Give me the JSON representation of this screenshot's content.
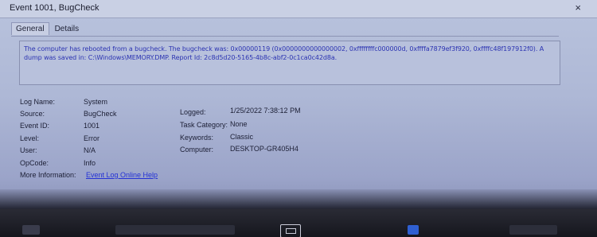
{
  "window": {
    "title": "Event 1001, BugCheck",
    "close_glyph": "×"
  },
  "tabs": [
    {
      "label": "General",
      "active": true
    },
    {
      "label": "Details",
      "active": false
    }
  ],
  "description": "The computer has rebooted from a bugcheck.  The bugcheck was: 0x00000119 (0x0000000000000002, 0xffffffffc000000d, 0xffffa7879ef3f920, 0xffffc48f197912f0). A dump was saved in: C:\\Windows\\MEMORY.DMP. Report Id: 2c8d5d20-5165-4b8c-abf2-0c1ca0c42d8a.",
  "properties": {
    "log_name": {
      "label": "Log Name:",
      "value": "System"
    },
    "source": {
      "label": "Source:",
      "value": "BugCheck"
    },
    "event_id": {
      "label": "Event ID:",
      "value": "1001"
    },
    "level": {
      "label": "Level:",
      "value": "Error"
    },
    "user": {
      "label": "User:",
      "value": "N/A"
    },
    "opcode": {
      "label": "OpCode:",
      "value": "Info"
    },
    "more_info": {
      "label": "More Information:",
      "value": "Event Log Online Help"
    },
    "logged": {
      "label": "Logged:",
      "value": "1/25/2022 7:38:12 PM"
    },
    "task_category": {
      "label": "Task Category:",
      "value": "None"
    },
    "keywords": {
      "label": "Keywords:",
      "value": "Classic"
    },
    "computer": {
      "label": "Computer:",
      "value": "DESKTOP-GR405H4"
    }
  },
  "colors": {
    "link": "#2432d6",
    "description_text": "#2b33b2",
    "taskbar": "#15161d"
  }
}
